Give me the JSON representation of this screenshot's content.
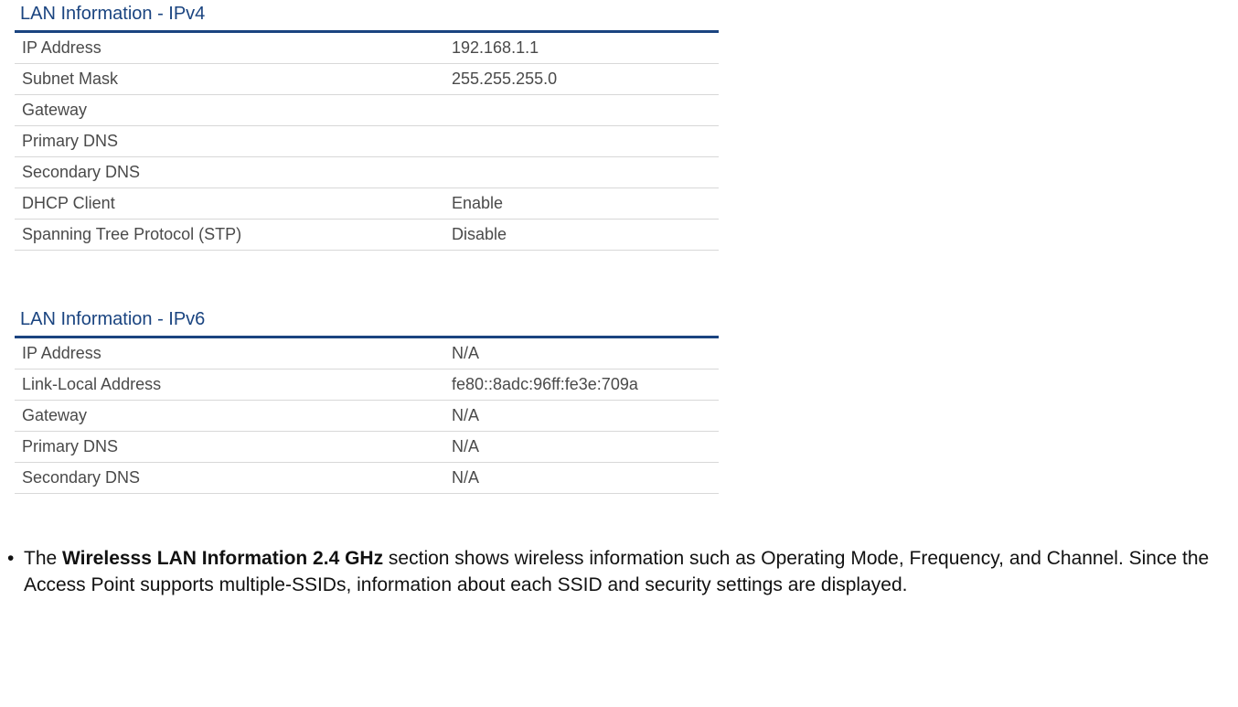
{
  "ipv4": {
    "title": "LAN Information - IPv4",
    "rows": [
      {
        "label": "IP Address",
        "value": "192.168.1.1"
      },
      {
        "label": "Subnet Mask",
        "value": "255.255.255.0"
      },
      {
        "label": "Gateway",
        "value": ""
      },
      {
        "label": "Primary DNS",
        "value": ""
      },
      {
        "label": "Secondary DNS",
        "value": ""
      },
      {
        "label": "DHCP Client",
        "value": "Enable"
      },
      {
        "label": "Spanning Tree Protocol (STP)",
        "value": "Disable"
      }
    ]
  },
  "ipv6": {
    "title": "LAN Information - IPv6",
    "rows": [
      {
        "label": "IP Address",
        "value": "N/A"
      },
      {
        "label": "Link-Local Address",
        "value": "fe80::8adc:96ff:fe3e:709a"
      },
      {
        "label": "Gateway",
        "value": "N/A"
      },
      {
        "label": "Primary DNS",
        "value": "N/A"
      },
      {
        "label": "Secondary DNS",
        "value": "N/A"
      }
    ]
  },
  "note": {
    "bullet": "•",
    "pre": "The ",
    "bold": "Wirelesss LAN Information 2.4 GHz",
    "post": " section shows wireless information such as Operating Mode, Frequency, and Channel. Since the Access Point supports multiple-SSIDs, information about each SSID and security settings are displayed."
  }
}
